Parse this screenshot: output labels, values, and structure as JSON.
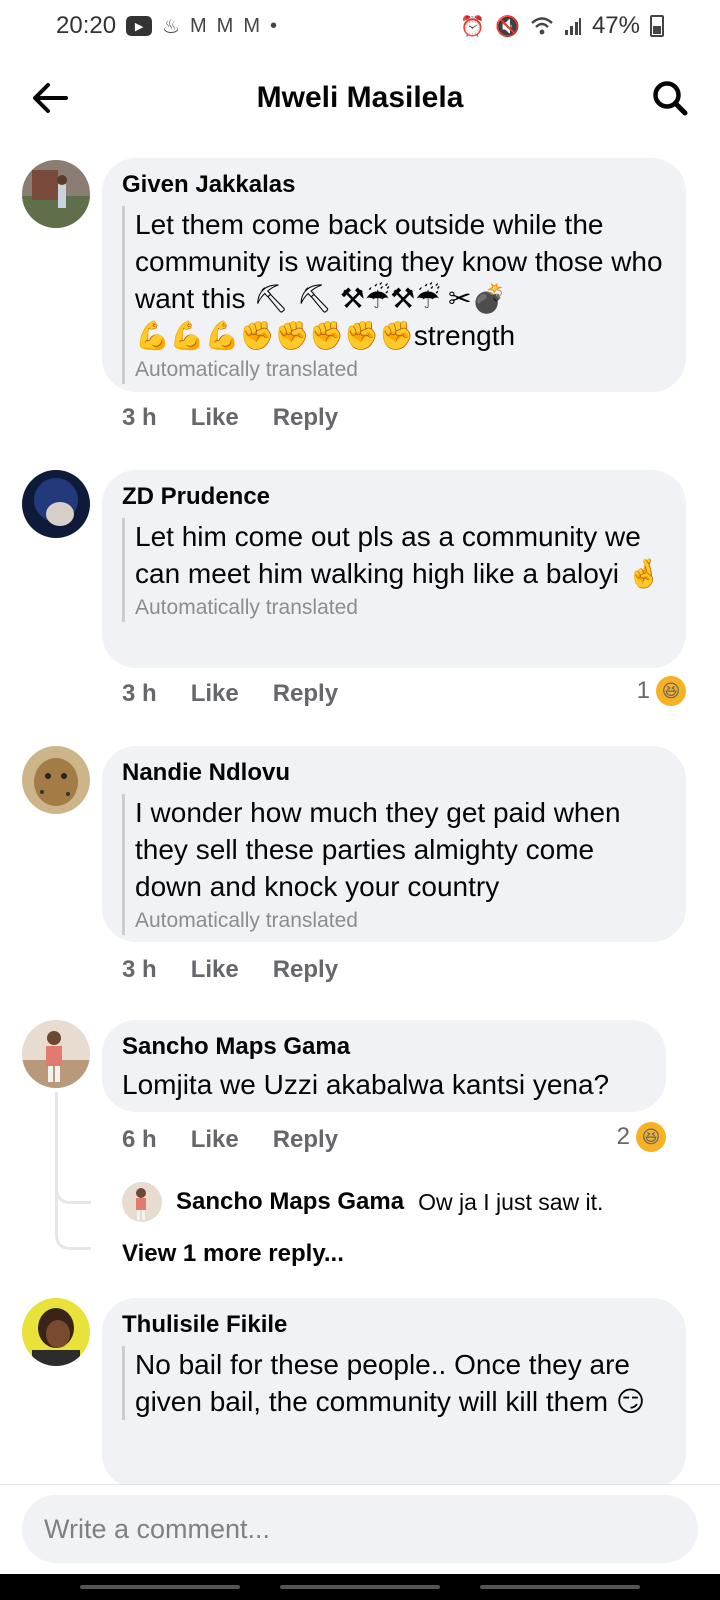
{
  "status_bar": {
    "time": "20:20",
    "notification_icons": [
      "youtube-icon",
      "app-icon",
      "gmail-icon",
      "gmail-icon",
      "gmail-icon",
      "dot-icon"
    ],
    "battery": "47%"
  },
  "header": {
    "title": "Mweli Masilela"
  },
  "comments": [
    {
      "author": "Given Jakkalas",
      "text": "Let them come back outside while the community is waiting they know those who want this ⛏ ⛏ ⚒☔⚒☔ ✂💣",
      "text2": "💪💪💪✊✊✊✊✊strength",
      "translated": "Automatically translated",
      "time": "3 h",
      "like": "Like",
      "reply": "Reply",
      "avatar_color": "#6b5a4e"
    },
    {
      "author": "ZD Prudence",
      "text": "Let him come out pls as a community we can meet him walking high like a baloyi 🤞",
      "translated": "Automatically translated",
      "time": "3 h",
      "like": "Like",
      "reply": "Reply",
      "reaction_count": "1",
      "reaction_icon": "haha-icon",
      "avatar_color": "#1c2f5e"
    },
    {
      "author": "Nandie Ndlovu",
      "text": "I wonder how much they get paid when they sell these parties almighty come down and knock your country",
      "translated": "Automatically translated",
      "time": "3 h",
      "like": "Like",
      "reply": "Reply",
      "avatar_color": "#8a6a3c"
    },
    {
      "author": "Sancho Maps Gama",
      "text": "Lomjita we Uzzi akabalwa kantsi yena?",
      "time": "6 h",
      "like": "Like",
      "reply": "Reply",
      "reaction_count": "2",
      "reaction_icon": "haha-icon",
      "avatar_color": "#c9a58a",
      "reply_preview": {
        "author": "Sancho Maps Gama",
        "text": "Ow ja I just saw it."
      },
      "view_more": "View 1 more reply..."
    },
    {
      "author": "Thulisile Fikile",
      "text": "No bail for these people.. Once they are given bail, the community will kill them 😏",
      "avatar_color": "#d4c21a"
    }
  ],
  "composer": {
    "placeholder": "Write a comment..."
  }
}
